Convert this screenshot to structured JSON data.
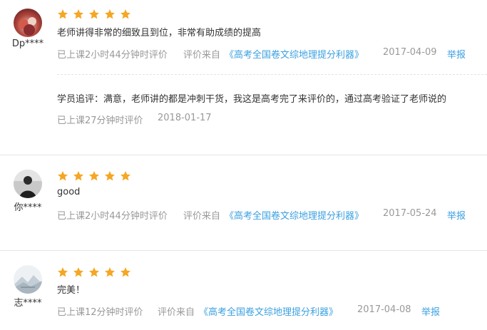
{
  "colors": {
    "star": "#f5a623",
    "link": "#3aa0e0",
    "meta_text": "#999999",
    "body_text": "#333333"
  },
  "reviews": [
    {
      "username": "Dp****",
      "avatar_icon": "avatar-photo-red-flowers",
      "rating": 5,
      "content": "老师讲得非常的细致且到位，非常有助成绩的提高",
      "study_time": "已上课2小时44分钟时评价",
      "source_prefix": "评价来自",
      "source_course": "《高考全国卷文综地理提分利器》",
      "date": "2017-04-09",
      "report_label": "举报",
      "followup": {
        "content": "学员追评：满意，老师讲的都是冲刺干货，我这是高考完了来评价的，通过高考验证了老师说的",
        "study_time": "已上课27分钟时评价",
        "date": "2018-01-17"
      }
    },
    {
      "username": "你****",
      "avatar_icon": "avatar-photo-dark-figure",
      "rating": 5,
      "content": "good",
      "study_time": "已上课2小时44分钟时评价",
      "source_prefix": "评价来自",
      "source_course": "《高考全国卷文综地理提分利器》",
      "date": "2017-05-24",
      "report_label": "举报"
    },
    {
      "username": "志****",
      "avatar_icon": "avatar-photo-snowy-landscape",
      "rating": 5,
      "content": "完美！",
      "study_time": "已上课12分钟时评价",
      "source_prefix": "评价来自",
      "source_course": "《高考全国卷文综地理提分利器》",
      "date": "2017-04-08",
      "report_label": "举报"
    }
  ]
}
